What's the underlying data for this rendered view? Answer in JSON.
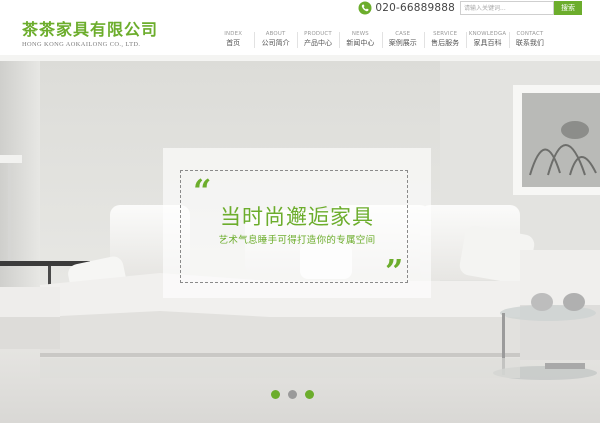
{
  "company": {
    "name_cn": "茶茶家具有限公司",
    "name_en": "HONG KONG AOKAILONG CO., LTD."
  },
  "topbar": {
    "phone_icon": "phone-icon",
    "phone": "020-66889888",
    "search_placeholder": "请输入关键词...",
    "search_button": "搜索"
  },
  "nav": {
    "items": [
      {
        "en": "INDEX",
        "cn": "首页"
      },
      {
        "en": "ABOUT",
        "cn": "公司简介"
      },
      {
        "en": "PRODUCT",
        "cn": "产品中心"
      },
      {
        "en": "NEWS",
        "cn": "新闻中心"
      },
      {
        "en": "CASE",
        "cn": "案例展示"
      },
      {
        "en": "SERVICE",
        "cn": "售后服务"
      },
      {
        "en": "KNOWLEDGA",
        "cn": "家具百科"
      },
      {
        "en": "CONTACT",
        "cn": "联系我们"
      }
    ]
  },
  "banner": {
    "headline": "当时尚邂逅家具",
    "subline": "艺术气息睡手可得打造你的专属空间",
    "quote_open": "“",
    "quote_close": "”",
    "slides": 3,
    "active_slide": 1
  },
  "colors": {
    "accent": "#6cad2c",
    "dot_inactive": "#9a9a9a",
    "text_dark": "#444444"
  }
}
